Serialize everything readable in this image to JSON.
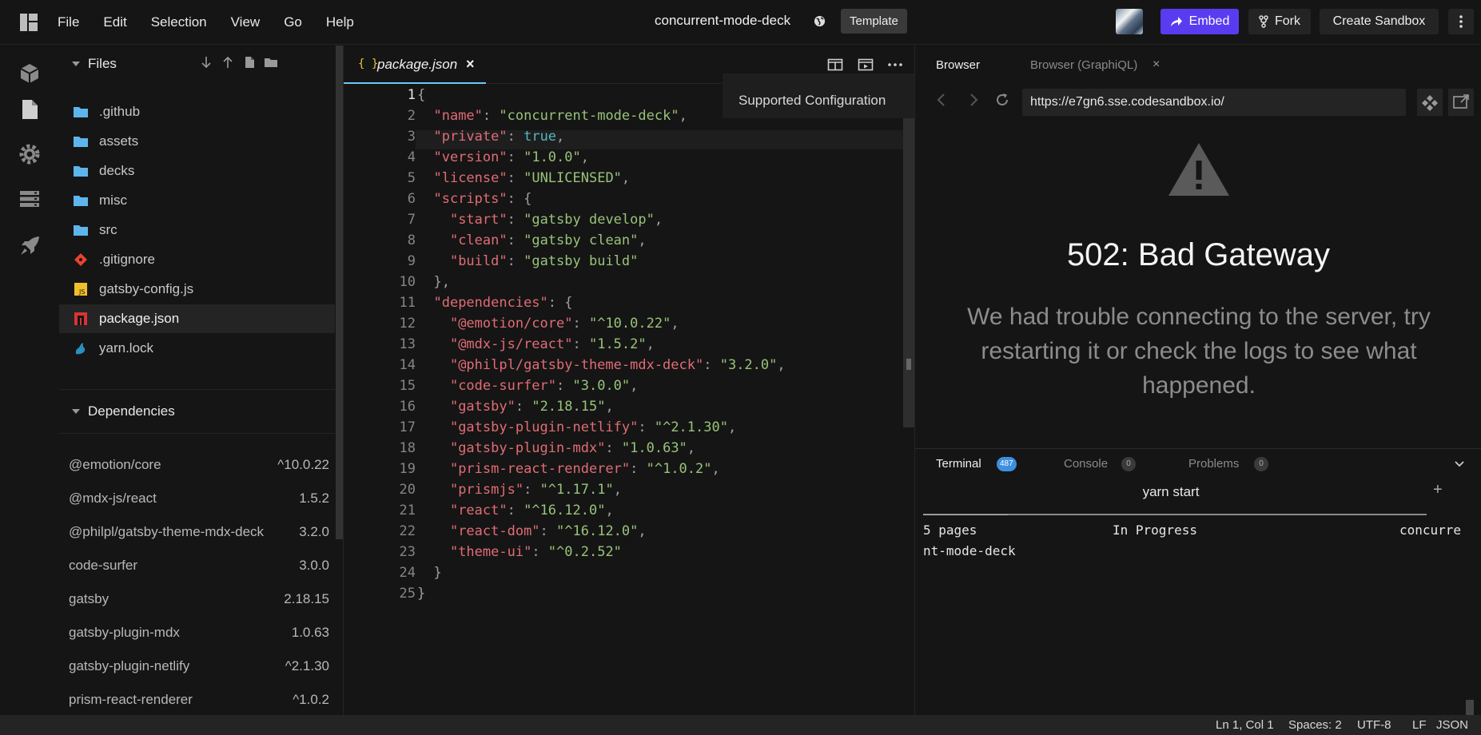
{
  "app": {
    "title": "concurrent-mode-deck",
    "template_label": "Template",
    "menu": [
      "File",
      "Edit",
      "Selection",
      "View",
      "Go",
      "Help"
    ],
    "embed_label": "Embed",
    "fork_label": "Fork",
    "create_label": "Create Sandbox",
    "accent_color": "#5a3cf0"
  },
  "explorer": {
    "files_title": "Files",
    "files": [
      {
        "name": ".github",
        "icon": "folder-icon"
      },
      {
        "name": "assets",
        "icon": "folder-icon"
      },
      {
        "name": "decks",
        "icon": "folder-icon"
      },
      {
        "name": "misc",
        "icon": "folder-icon"
      },
      {
        "name": "src",
        "icon": "folder-icon"
      },
      {
        "name": ".gitignore",
        "icon": "git-icon"
      },
      {
        "name": "gatsby-config.js",
        "icon": "js-icon"
      },
      {
        "name": "package.json",
        "icon": "npm-icon",
        "active": true
      },
      {
        "name": "yarn.lock",
        "icon": "yarn-icon"
      }
    ],
    "dependencies_title": "Dependencies",
    "dependencies": [
      {
        "name": "@emotion/core",
        "version": "^10.0.22"
      },
      {
        "name": "@mdx-js/react",
        "version": "1.5.2"
      },
      {
        "name": "@philpl/gatsby-theme-mdx-deck",
        "version": "3.2.0"
      },
      {
        "name": "code-surfer",
        "version": "3.0.0"
      },
      {
        "name": "gatsby",
        "version": "2.18.15"
      },
      {
        "name": "gatsby-plugin-mdx",
        "version": "1.0.63"
      },
      {
        "name": "gatsby-plugin-netlify",
        "version": "^2.1.30"
      },
      {
        "name": "prism-react-renderer",
        "version": "^1.0.2"
      }
    ]
  },
  "editor": {
    "tab_icon": "{ }",
    "tab_label": "package.json",
    "tab_close": "×",
    "tooltip": "Supported Configuration",
    "code_lines": [
      [
        {
          "t": "{",
          "c": "p"
        }
      ],
      [
        {
          "t": "  "
        },
        {
          "t": "\"name\"",
          "c": "k"
        },
        {
          "t": ": ",
          "c": "p"
        },
        {
          "t": "\"concurrent-mode-deck\"",
          "c": "s"
        },
        {
          "t": ",",
          "c": "p"
        }
      ],
      [
        {
          "t": "  "
        },
        {
          "t": "\"private\"",
          "c": "k"
        },
        {
          "t": ": ",
          "c": "p"
        },
        {
          "t": "true",
          "c": "b"
        },
        {
          "t": ",",
          "c": "p"
        }
      ],
      [
        {
          "t": "  "
        },
        {
          "t": "\"version\"",
          "c": "k"
        },
        {
          "t": ": ",
          "c": "p"
        },
        {
          "t": "\"1.0.0\"",
          "c": "s"
        },
        {
          "t": ",",
          "c": "p"
        }
      ],
      [
        {
          "t": "  "
        },
        {
          "t": "\"license\"",
          "c": "k"
        },
        {
          "t": ": ",
          "c": "p"
        },
        {
          "t": "\"UNLICENSED\"",
          "c": "s"
        },
        {
          "t": ",",
          "c": "p"
        }
      ],
      [
        {
          "t": "  "
        },
        {
          "t": "\"scripts\"",
          "c": "k"
        },
        {
          "t": ": {",
          "c": "p"
        }
      ],
      [
        {
          "t": "    "
        },
        {
          "t": "\"start\"",
          "c": "k"
        },
        {
          "t": ": ",
          "c": "p"
        },
        {
          "t": "\"gatsby develop\"",
          "c": "s"
        },
        {
          "t": ",",
          "c": "p"
        }
      ],
      [
        {
          "t": "    "
        },
        {
          "t": "\"clean\"",
          "c": "k"
        },
        {
          "t": ": ",
          "c": "p"
        },
        {
          "t": "\"gatsby clean\"",
          "c": "s"
        },
        {
          "t": ",",
          "c": "p"
        }
      ],
      [
        {
          "t": "    "
        },
        {
          "t": "\"build\"",
          "c": "k"
        },
        {
          "t": ": ",
          "c": "p"
        },
        {
          "t": "\"gatsby build\"",
          "c": "s"
        }
      ],
      [
        {
          "t": "  },",
          "c": "p"
        }
      ],
      [
        {
          "t": "  "
        },
        {
          "t": "\"dependencies\"",
          "c": "k"
        },
        {
          "t": ": {",
          "c": "p"
        }
      ],
      [
        {
          "t": "    "
        },
        {
          "t": "\"@emotion/core\"",
          "c": "k"
        },
        {
          "t": ": ",
          "c": "p"
        },
        {
          "t": "\"^10.0.22\"",
          "c": "s"
        },
        {
          "t": ",",
          "c": "p"
        }
      ],
      [
        {
          "t": "    "
        },
        {
          "t": "\"@mdx-js/react\"",
          "c": "k"
        },
        {
          "t": ": ",
          "c": "p"
        },
        {
          "t": "\"1.5.2\"",
          "c": "s"
        },
        {
          "t": ",",
          "c": "p"
        }
      ],
      [
        {
          "t": "    "
        },
        {
          "t": "\"@philpl/gatsby-theme-mdx-deck\"",
          "c": "k"
        },
        {
          "t": ": ",
          "c": "p"
        },
        {
          "t": "\"3.2.0\"",
          "c": "s"
        },
        {
          "t": ",",
          "c": "p"
        }
      ],
      [
        {
          "t": "    "
        },
        {
          "t": "\"code-surfer\"",
          "c": "k"
        },
        {
          "t": ": ",
          "c": "p"
        },
        {
          "t": "\"3.0.0\"",
          "c": "s"
        },
        {
          "t": ",",
          "c": "p"
        }
      ],
      [
        {
          "t": "    "
        },
        {
          "t": "\"gatsby\"",
          "c": "k"
        },
        {
          "t": ": ",
          "c": "p"
        },
        {
          "t": "\"2.18.15\"",
          "c": "s"
        },
        {
          "t": ",",
          "c": "p"
        }
      ],
      [
        {
          "t": "    "
        },
        {
          "t": "\"gatsby-plugin-netlify\"",
          "c": "k"
        },
        {
          "t": ": ",
          "c": "p"
        },
        {
          "t": "\"^2.1.30\"",
          "c": "s"
        },
        {
          "t": ",",
          "c": "p"
        }
      ],
      [
        {
          "t": "    "
        },
        {
          "t": "\"gatsby-plugin-mdx\"",
          "c": "k"
        },
        {
          "t": ": ",
          "c": "p"
        },
        {
          "t": "\"1.0.63\"",
          "c": "s"
        },
        {
          "t": ",",
          "c": "p"
        }
      ],
      [
        {
          "t": "    "
        },
        {
          "t": "\"prism-react-renderer\"",
          "c": "k"
        },
        {
          "t": ": ",
          "c": "p"
        },
        {
          "t": "\"^1.0.2\"",
          "c": "s"
        },
        {
          "t": ",",
          "c": "p"
        }
      ],
      [
        {
          "t": "    "
        },
        {
          "t": "\"prismjs\"",
          "c": "k"
        },
        {
          "t": ": ",
          "c": "p"
        },
        {
          "t": "\"^1.17.1\"",
          "c": "s"
        },
        {
          "t": ",",
          "c": "p"
        }
      ],
      [
        {
          "t": "    "
        },
        {
          "t": "\"react\"",
          "c": "k"
        },
        {
          "t": ": ",
          "c": "p"
        },
        {
          "t": "\"^16.12.0\"",
          "c": "s"
        },
        {
          "t": ",",
          "c": "p"
        }
      ],
      [
        {
          "t": "    "
        },
        {
          "t": "\"react-dom\"",
          "c": "k"
        },
        {
          "t": ": ",
          "c": "p"
        },
        {
          "t": "\"^16.12.0\"",
          "c": "s"
        },
        {
          "t": ",",
          "c": "p"
        }
      ],
      [
        {
          "t": "    "
        },
        {
          "t": "\"theme-ui\"",
          "c": "k"
        },
        {
          "t": ": ",
          "c": "p"
        },
        {
          "t": "\"^0.2.52\"",
          "c": "s"
        }
      ],
      [
        {
          "t": "  }",
          "c": "p"
        }
      ],
      [
        {
          "t": "}",
          "c": "p"
        }
      ]
    ]
  },
  "browser": {
    "tab_browser": "Browser",
    "tab_graphiql": "Browser (GraphiQL)",
    "tab_close": "×",
    "url": "https://e7gn6.sse.codesandbox.io/",
    "error_title": "502: Bad Gateway",
    "error_message": "We had trouble connecting to the server, try restarting it or check the logs to see what happened."
  },
  "terminal": {
    "tabs": [
      {
        "label": "Terminal",
        "badge": "487",
        "active": true
      },
      {
        "label": "Console",
        "badge": "0"
      },
      {
        "label": "Problems",
        "badge": "0"
      }
    ],
    "session_title": "yarn start",
    "add_symbol": "+",
    "separator_tail": "___________",
    "status_pages": "5 pages",
    "status_progress": "In Progress",
    "status_project_a": "concurre",
    "status_project_b": "nt-mode-deck"
  },
  "statusbar": {
    "position": "Ln 1, Col 1",
    "spaces": "Spaces: 2",
    "encoding": "UTF-8",
    "eol": "LF",
    "language": "JSON"
  }
}
